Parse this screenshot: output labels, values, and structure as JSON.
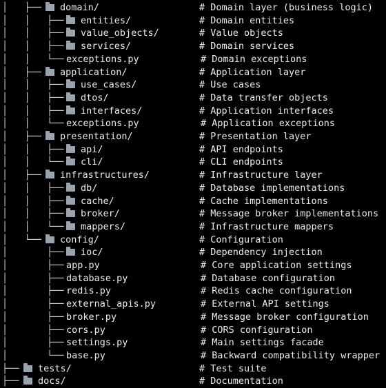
{
  "tree": [
    {
      "prefix": "│   ├──",
      "indent": 0,
      "folder": true,
      "name": "domain/",
      "comment": "# Domain layer (business logic)"
    },
    {
      "prefix": "│   │   ├──",
      "indent": 1,
      "folder": true,
      "name": "entities/",
      "comment": "# Domain entities"
    },
    {
      "prefix": "│   │   ├──",
      "indent": 1,
      "folder": true,
      "name": "value_objects/",
      "comment": "# Value objects"
    },
    {
      "prefix": "│   │   ├──",
      "indent": 1,
      "folder": true,
      "name": "services/",
      "comment": "# Domain services"
    },
    {
      "prefix": "│   │   └──",
      "indent": 1,
      "folder": false,
      "name": "exceptions.py",
      "comment": "# Domain exceptions"
    },
    {
      "prefix": "│   ├──",
      "indent": 0,
      "folder": true,
      "name": "application/",
      "comment": "# Application layer"
    },
    {
      "prefix": "│   │   ├──",
      "indent": 1,
      "folder": true,
      "name": "use_cases/",
      "comment": "# Use cases"
    },
    {
      "prefix": "│   │   ├──",
      "indent": 1,
      "folder": true,
      "name": "dtos/",
      "comment": "# Data transfer objects"
    },
    {
      "prefix": "│   │   ├──",
      "indent": 1,
      "folder": true,
      "name": "interfaces/",
      "comment": "# Application interfaces"
    },
    {
      "prefix": "│   │   └──",
      "indent": 1,
      "folder": false,
      "name": "exceptions.py",
      "comment": "# Application exceptions"
    },
    {
      "prefix": "│   ├──",
      "indent": 0,
      "folder": true,
      "name": "presentation/",
      "comment": "# Presentation layer"
    },
    {
      "prefix": "│   │   ├──",
      "indent": 1,
      "folder": true,
      "name": "api/",
      "comment": "# API endpoints"
    },
    {
      "prefix": "│   │   └──",
      "indent": 1,
      "folder": true,
      "name": "cli/",
      "comment": "# CLI endpoints"
    },
    {
      "prefix": "│   ├──",
      "indent": 0,
      "folder": true,
      "name": "infrastructures/",
      "comment": "# Infrastructure layer"
    },
    {
      "prefix": "│   │   ├──",
      "indent": 1,
      "folder": true,
      "name": "db/",
      "comment": "# Database implementations"
    },
    {
      "prefix": "│   │   ├──",
      "indent": 1,
      "folder": true,
      "name": "cache/",
      "comment": "# Cache implementations"
    },
    {
      "prefix": "│   │   ├──",
      "indent": 1,
      "folder": true,
      "name": "broker/",
      "comment": "# Message broker implementations"
    },
    {
      "prefix": "│   │   └──",
      "indent": 1,
      "folder": true,
      "name": "mappers/",
      "comment": "# Infrastructure mappers"
    },
    {
      "prefix": "│   └──",
      "indent": 0,
      "folder": true,
      "name": "config/",
      "comment": "# Configuration"
    },
    {
      "prefix": "│       ├──",
      "indent": 1,
      "folder": true,
      "name": "ioc/",
      "comment": "# Dependency injection"
    },
    {
      "prefix": "│       ├──",
      "indent": 1,
      "folder": false,
      "name": "app.py",
      "comment": "# Core application settings"
    },
    {
      "prefix": "│       ├──",
      "indent": 1,
      "folder": false,
      "name": "database.py",
      "comment": "# Database configuration"
    },
    {
      "prefix": "│       ├──",
      "indent": 1,
      "folder": false,
      "name": "redis.py",
      "comment": "# Redis cache configuration"
    },
    {
      "prefix": "│       ├──",
      "indent": 1,
      "folder": false,
      "name": "external_apis.py",
      "comment": "# External API settings"
    },
    {
      "prefix": "│       ├──",
      "indent": 1,
      "folder": false,
      "name": "broker.py",
      "comment": "# Message broker configuration"
    },
    {
      "prefix": "│       ├──",
      "indent": 1,
      "folder": false,
      "name": "cors.py",
      "comment": "# CORS configuration"
    },
    {
      "prefix": "│       ├──",
      "indent": 1,
      "folder": false,
      "name": "settings.py",
      "comment": "# Main settings facade"
    },
    {
      "prefix": "│       └──",
      "indent": 1,
      "folder": false,
      "name": "base.py",
      "comment": "# Backward compatibility wrapper"
    },
    {
      "prefix": "├──",
      "indent": -1,
      "folder": true,
      "name": "tests/",
      "comment": "# Test suite"
    },
    {
      "prefix": "├──",
      "indent": -1,
      "folder": true,
      "name": "docs/",
      "comment": "# Documentation"
    }
  ],
  "colors": {
    "background": "#000000",
    "text": "#ededed",
    "tree_lines": "#cfcfcf",
    "folder_icon": "#9aa4ad"
  },
  "icons": {
    "folder": "folder-icon"
  }
}
